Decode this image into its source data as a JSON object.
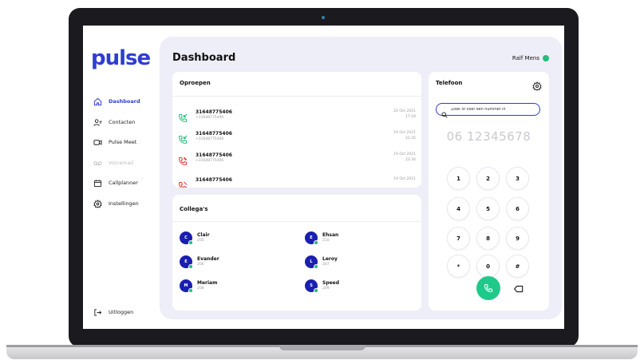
{
  "app": {
    "logo": "pulse",
    "brand_color": "#2e3dd1",
    "accent_green": "#1fc98a"
  },
  "sidebar": {
    "items": [
      {
        "label": "Dashboard",
        "icon": "home-icon",
        "active": true
      },
      {
        "label": "Contacten",
        "icon": "contacts-icon"
      },
      {
        "label": "Pulse Meet",
        "icon": "video-icon"
      },
      {
        "label": "Voicemail",
        "icon": "voicemail-icon",
        "disabled": true
      },
      {
        "label": "Callplanner",
        "icon": "calendar-icon"
      },
      {
        "label": "Instellingen",
        "icon": "gear-icon"
      }
    ],
    "logout_label": "Uitloggen"
  },
  "header": {
    "title": "Dashboard",
    "user_name": "Ralf Mens",
    "user_status_color": "#1fbf7a"
  },
  "calls": {
    "title": "Oproepen",
    "rows": [
      {
        "number": "31648775406",
        "sub": "+31648775406",
        "date": "22 Oct 2021",
        "time": "17:18",
        "type": "incoming",
        "color": "#1fbf7a"
      },
      {
        "number": "31648775406",
        "sub": "+31648775406",
        "date": "19 Oct 2021",
        "time": "22:35",
        "type": "incoming",
        "color": "#1fbf7a"
      },
      {
        "number": "31648775406",
        "sub": "+31648775406",
        "date": "19 Oct 2021",
        "time": "22:34",
        "type": "missed",
        "color": "#e53935"
      },
      {
        "number": "31648775406",
        "sub": "",
        "date": "19 Oct 2021",
        "time": "",
        "type": "missed",
        "color": "#e53935"
      }
    ]
  },
  "colleagues": {
    "title": "Collega's",
    "items": [
      {
        "initial": "C",
        "name": "Clair",
        "ext": "205"
      },
      {
        "initial": "E",
        "name": "Ehsan",
        "ext": "210"
      },
      {
        "initial": "E",
        "name": "Evander",
        "ext": "206"
      },
      {
        "initial": "L",
        "name": "Leroy",
        "ext": "207"
      },
      {
        "initial": "M",
        "name": "Meriam",
        "ext": "208"
      },
      {
        "initial": "S",
        "name": "Speed",
        "ext": "209"
      }
    ]
  },
  "phone": {
    "title": "Telefoon",
    "search_placeholder": "Zoek of voer een nummer in",
    "display_number": "06 12345678",
    "keys": [
      "1",
      "2",
      "3",
      "4",
      "5",
      "6",
      "7",
      "8",
      "9",
      "*",
      "0",
      "#"
    ]
  }
}
